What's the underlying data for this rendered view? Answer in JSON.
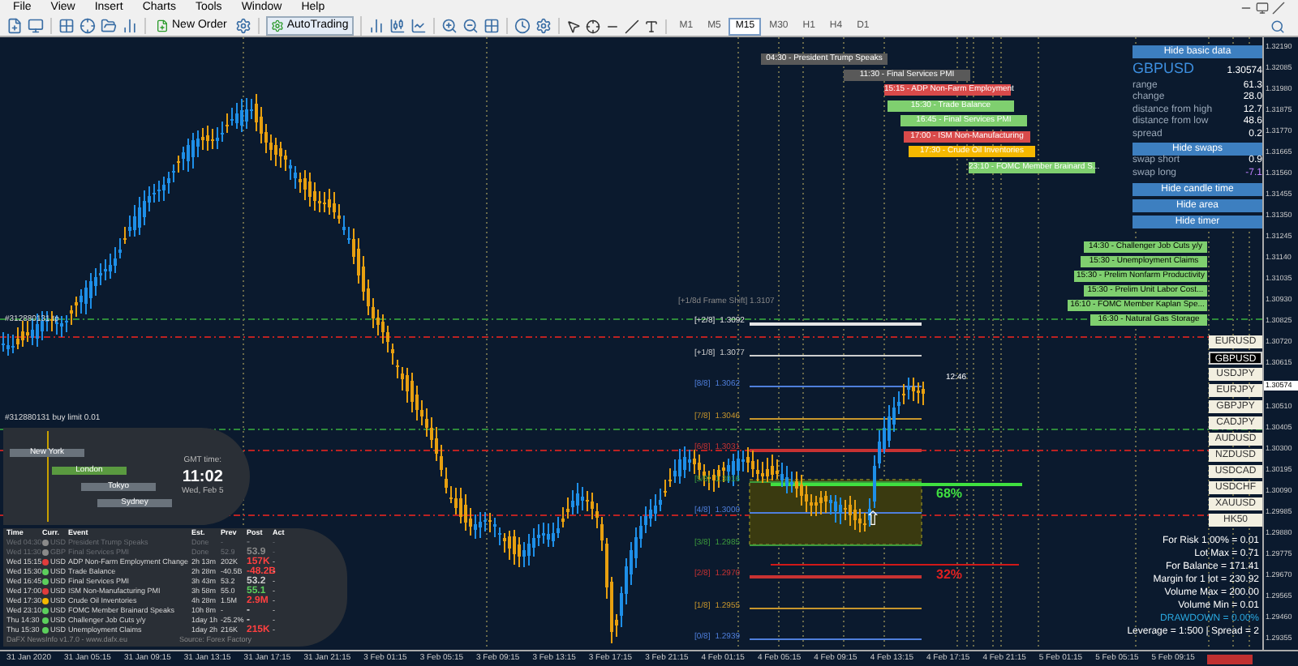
{
  "menu": [
    "File",
    "View",
    "Insert",
    "Charts",
    "Tools",
    "Window",
    "Help"
  ],
  "toolbar": {
    "new_order": "New Order",
    "auto_trading": "AutoTrading",
    "timeframes": [
      {
        "label": "M1",
        "selected": false
      },
      {
        "label": "M5",
        "selected": false
      },
      {
        "label": "M15",
        "selected": true
      },
      {
        "label": "M30",
        "selected": false
      },
      {
        "label": "H1",
        "selected": false
      },
      {
        "label": "H4",
        "selected": false
      },
      {
        "label": "D1",
        "selected": false
      }
    ]
  },
  "chart": {
    "order_labels": [
      "#312880131 tp",
      "#312880131 buy limit 0.01"
    ],
    "news_bars": [
      {
        "text": "04:30 - President Trump Speaks",
        "color": "#595959"
      },
      {
        "text": "11:30 - Final Services PMI",
        "color": "#595959"
      },
      {
        "text": "15:15 - ADP Non-Farm Employment",
        "color": "#d94a4a"
      },
      {
        "text": "15:30 - Trade Balance",
        "color": "#7fcf6f"
      },
      {
        "text": "16:45 - Final Services PMI",
        "color": "#7fcf6f"
      },
      {
        "text": "17:00 - ISM Non-Manufacturing",
        "color": "#d94a4a"
      },
      {
        "text": "17:30 - Crude Oil Inventories",
        "color": "#f5b800"
      },
      {
        "text": "23:10 - FOMC Member Brainard S...",
        "color": "#7fcf6f"
      }
    ],
    "news_bars_late": [
      {
        "text": "14:30 - Challenger Job Cuts y/y",
        "color": "#7fcf6f"
      },
      {
        "text": "15:30 - Unemployment Claims",
        "color": "#7fcf6f"
      },
      {
        "text": "15:30 - Prelim Nonfarm Productivity",
        "color": "#7fcf6f"
      },
      {
        "text": "15:30 - Prelim Unit Labor Cost...",
        "color": "#7fcf6f"
      },
      {
        "text": "16:10 - FOMC Member Kaplan Spe...",
        "color": "#7fcf6f"
      },
      {
        "text": "16:30 - Natural Gas Storage",
        "color": "#7fcf6f"
      }
    ],
    "info": {
      "hide_basic": "Hide basic data",
      "symbol": "GBPUSD",
      "price": "1.30574",
      "rows": [
        {
          "label": "range",
          "value": "61.3"
        },
        {
          "label": "change",
          "value": "28.0"
        },
        {
          "label": "distance from high",
          "value": "12.7"
        },
        {
          "label": "distance from low",
          "value": "48.6"
        },
        {
          "label": "spread",
          "value": "0.2"
        }
      ],
      "hide_swaps": "Hide swaps",
      "swaps": [
        {
          "label": "swap short",
          "value": "0.9",
          "negative": false
        },
        {
          "label": "swap long",
          "value": "-7.1",
          "negative": true
        }
      ],
      "buttons": [
        "Hide candle time",
        "Hide area",
        "Hide timer"
      ]
    },
    "symbols": [
      {
        "label": "EURUSD",
        "selected": false
      },
      {
        "label": "GBPUSD",
        "selected": true
      },
      {
        "label": "USDJPY",
        "selected": false
      },
      {
        "label": "EURJPY",
        "selected": false
      },
      {
        "label": "GBPJPY",
        "selected": false
      },
      {
        "label": "CADJPY",
        "selected": false
      },
      {
        "label": "AUDUSD",
        "selected": false
      },
      {
        "label": "NZDUSD",
        "selected": false
      },
      {
        "label": "USDCAD",
        "selected": false
      },
      {
        "label": "USDCHF",
        "selected": false
      },
      {
        "label": "XAUUSD",
        "selected": false
      },
      {
        "label": "HK50",
        "selected": false
      }
    ],
    "murrey": {
      "shift_label": "[+1/8d Frame Shift]  1.3107",
      "levels": [
        {
          "label": "[+2/8]",
          "price": "1.3092",
          "color": "#e6e6e6"
        },
        {
          "label": "[+1/8]",
          "price": "1.3077",
          "color": "#cfcfcf"
        },
        {
          "label": "[8/8]",
          "price": "1.3062",
          "color": "#4f7fdc"
        },
        {
          "label": "[7/8]",
          "price": "1.3046",
          "color": "#c8962c"
        },
        {
          "label": "[6/8]",
          "price": "1.3031",
          "color": "#c83232"
        },
        {
          "label": "[5/8]",
          "price": "1.3016",
          "color": "#3c9a3c"
        },
        {
          "label": "[4/8]",
          "price": "1.3000",
          "color": "#4f7fdc"
        },
        {
          "label": "[3/8]",
          "price": "1.2985",
          "color": "#3c9a3c"
        },
        {
          "label": "[2/8]",
          "price": "1.2970",
          "color": "#c83232"
        },
        {
          "label": "[1/8]",
          "price": "1.2955",
          "color": "#c8962c"
        },
        {
          "label": "[0/8]",
          "price": "1.2939",
          "color": "#4f7fdc"
        }
      ]
    },
    "zone": {
      "upper_pct": "68%",
      "lower_pct": "32%",
      "arrow": "⇧"
    },
    "candle_time": "12:46",
    "account": [
      "For Risk 1.00% = 0.01",
      "Lot Max = 0.71",
      "For Balance = 171.41",
      "Margin for 1 lot = 230.92",
      "Volume Max = 200.00",
      "Volume Min = 0.01"
    ],
    "drawdown": "DRAWDOWN = 0.00%",
    "leverage": "Leverage = 1:500 | Spread = 2",
    "clock": {
      "sessions": [
        {
          "name": "New York",
          "selected": false
        },
        {
          "name": "London",
          "selected": true
        },
        {
          "name": "Tokyo",
          "selected": false
        },
        {
          "name": "Sydney",
          "selected": false
        }
      ],
      "label": "GMT time:",
      "time": "11:02",
      "date": "Wed, Feb 5"
    },
    "news_table": {
      "columns": [
        "Time",
        "Curr.",
        "Event",
        "Est.",
        "Prev",
        "Post",
        "Act"
      ],
      "rows": [
        {
          "time": "Wed 04:30",
          "curr": "USD",
          "event": "President Trump Speaks",
          "est": "Done",
          "prev": "-",
          "post": {
            "text": "-"
          },
          "act": "-",
          "color": "#8a8a8a",
          "past": true
        },
        {
          "time": "Wed 11:30",
          "curr": "GBP",
          "event": "Final Services PMI",
          "est": "Done",
          "prev": "52.9",
          "post": {
            "text": "53.9",
            "color": "#8a8a8a"
          },
          "act": "-",
          "color": "#8a8a8a",
          "past": true
        },
        {
          "time": "Wed 15:15",
          "curr": "USD",
          "event": "ADP Non-Farm Employment Change",
          "est": "2h 13m",
          "prev": "202K",
          "post": {
            "text": "157K",
            "color": "#ff4040"
          },
          "act": "-",
          "color": "#e03c3c",
          "past": false
        },
        {
          "time": "Wed 15:30",
          "curr": "USD",
          "event": "Trade Balance",
          "est": "2h 28m",
          "prev": "-40.5B",
          "post": {
            "text": "-48.2B",
            "color": "#ff4040"
          },
          "act": "-",
          "color": "#5ccf5c",
          "past": false
        },
        {
          "time": "Wed 16:45",
          "curr": "USD",
          "event": "Final Services PMI",
          "est": "3h 43m",
          "prev": "53.2",
          "post": {
            "text": "53.2",
            "color": "#d0d0d0"
          },
          "act": "-",
          "color": "#5ccf5c",
          "past": false
        },
        {
          "time": "Wed 17:00",
          "curr": "USD",
          "event": "ISM Non-Manufacturing PMI",
          "est": "3h 58m",
          "prev": "55.0",
          "post": {
            "text": "55.1",
            "color": "#5ccf5c"
          },
          "act": "-",
          "color": "#e03c3c",
          "past": false
        },
        {
          "time": "Wed 17:30",
          "curr": "USD",
          "event": "Crude Oil Inventories",
          "est": "4h 28m",
          "prev": "1.5M",
          "post": {
            "text": "2.9M",
            "color": "#ff4040"
          },
          "act": "-",
          "color": "#f5b800",
          "past": false
        },
        {
          "time": "Wed 23:10",
          "curr": "USD",
          "event": "FOMC Member Brainard Speaks",
          "est": "10h 8m",
          "prev": "-",
          "post": {
            "text": "-"
          },
          "act": "-",
          "color": "#5ccf5c",
          "past": false
        },
        {
          "time": "Thu 14:30",
          "curr": "USD",
          "event": "Challenger Job Cuts y/y",
          "est": "1day 1h",
          "prev": "-25.2%",
          "post": {
            "text": "-"
          },
          "act": "-",
          "color": "#5ccf5c",
          "past": false
        },
        {
          "time": "Thu 15:30",
          "curr": "USD",
          "event": "Unemployment Claims",
          "est": "1day 2h",
          "prev": "216K",
          "post": {
            "text": "215K",
            "color": "#ff4040"
          },
          "act": "-",
          "color": "#5ccf5c",
          "past": false
        }
      ],
      "footer": "DaFX NewsInfo v1.7.0  -  www.dafx.eu",
      "source": "Source: Forex Factory"
    },
    "price_axis": [
      "1.32190",
      "1.32085",
      "1.31980",
      "1.31875",
      "1.31770",
      "1.31665",
      "1.31560",
      "1.31455",
      "1.31350",
      "1.31245",
      "1.31140",
      "1.31035",
      "1.30930",
      "1.30825",
      "1.30720",
      "1.30615",
      "1.30510",
      "1.30405",
      "1.30300",
      "1.30195",
      "1.30090",
      "1.29985",
      "1.29880",
      "1.29775",
      "1.29670",
      "1.29565",
      "1.29460",
      "1.29355"
    ],
    "current_price": "1.30574",
    "time_axis": [
      "31 Jan 2020",
      "31 Jan 05:15",
      "31 Jan 09:15",
      "31 Jan 13:15",
      "31 Jan 17:15",
      "31 Jan 21:15",
      "3 Feb 01:15",
      "3 Feb 05:15",
      "3 Feb 09:15",
      "3 Feb 13:15",
      "3 Feb 17:15",
      "3 Feb 21:15",
      "4 Feb 01:15",
      "4 Feb 05:15",
      "4 Feb 09:15",
      "4 Feb 13:15",
      "4 Feb 17:15",
      "4 Feb 21:15",
      "5 Feb 01:15",
      "5 Feb 05:15",
      "5 Feb 09:15"
    ]
  }
}
